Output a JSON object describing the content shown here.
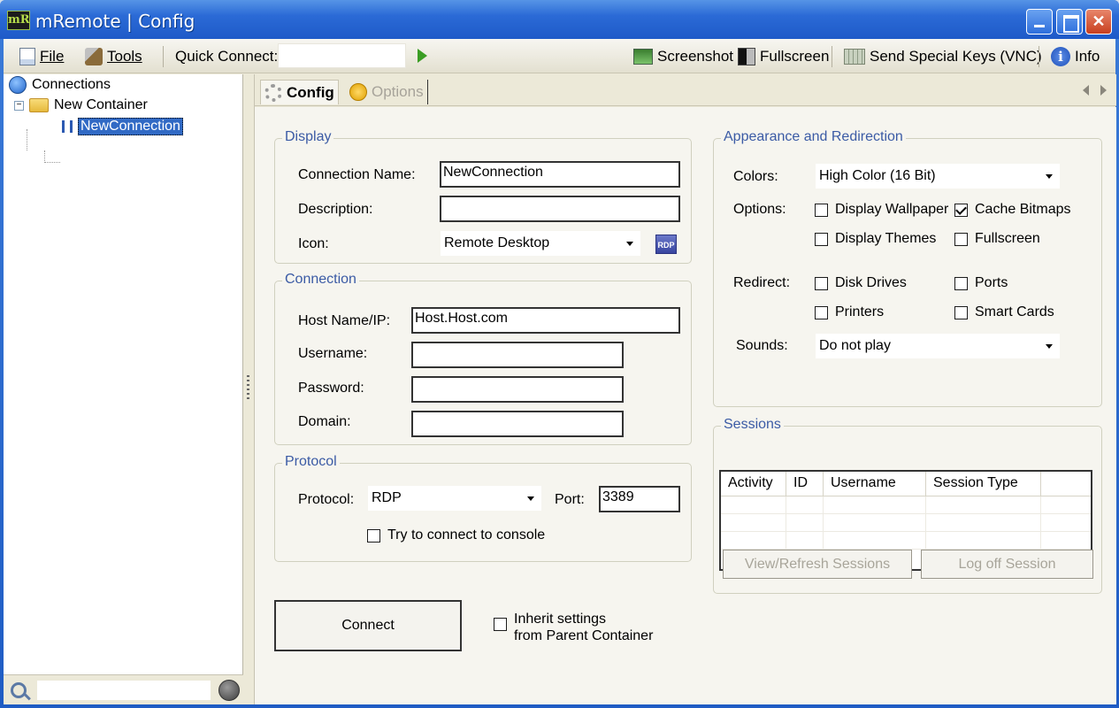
{
  "window": {
    "title": "mRemote | Config",
    "logo_text": "mR"
  },
  "toolbar": {
    "file_label": "File",
    "tools_label": "Tools",
    "quick_connect_label": "Quick Connect:",
    "quick_connect_value": "",
    "screenshot_label": "Screenshot",
    "fullscreen_label": "Fullscreen",
    "send_keys_label": "Send Special Keys (VNC)",
    "info_label": "Info"
  },
  "tree": {
    "root_label": "Connections",
    "container_label": "New Container",
    "connection_label": "NewConnection",
    "search_value": ""
  },
  "tabs": {
    "config_label": "Config",
    "options_label": "Options"
  },
  "display": {
    "title": "Display",
    "connection_name_label": "Connection Name:",
    "connection_name_value": "NewConnection",
    "description_label": "Description:",
    "description_value": "",
    "icon_label": "Icon:",
    "icon_value": "Remote Desktop",
    "icon_badge": "RDP"
  },
  "connection": {
    "title": "Connection",
    "host_label": "Host Name/IP:",
    "host_value": "Host.Host.com",
    "username_label": "Username:",
    "username_value": "",
    "password_label": "Password:",
    "password_value": "",
    "domain_label": "Domain:",
    "domain_value": ""
  },
  "protocol": {
    "title": "Protocol",
    "protocol_label": "Protocol:",
    "protocol_value": "RDP",
    "port_label": "Port:",
    "port_value": "3389",
    "console_label": "Try to connect to console",
    "console_checked": false
  },
  "actions": {
    "connect_label": "Connect",
    "inherit_line1": "Inherit settings",
    "inherit_line2": "from Parent Container",
    "inherit_checked": false
  },
  "appearance": {
    "title": "Appearance and Redirection",
    "colors_label": "Colors:",
    "colors_value": "High Color (16 Bit)",
    "options_label": "Options:",
    "display_wallpaper": "Display Wallpaper",
    "cache_bitmaps": "Cache Bitmaps",
    "display_themes": "Display Themes",
    "fullscreen": "Fullscreen",
    "redirect_label": "Redirect:",
    "disk_drives": "Disk Drives",
    "ports": "Ports",
    "printers": "Printers",
    "smart_cards": "Smart Cards",
    "sounds_label": "Sounds:",
    "sounds_value": "Do not play",
    "checked": {
      "display_wallpaper": false,
      "cache_bitmaps": true,
      "display_themes": false,
      "fullscreen": false,
      "disk_drives": false,
      "ports": false,
      "printers": false,
      "smart_cards": false
    }
  },
  "sessions": {
    "title": "Sessions",
    "columns": [
      "Activity",
      "ID",
      "Username",
      "Session Type"
    ],
    "rows": [],
    "view_refresh_label": "View/Refresh Sessions",
    "log_off_label": "Log off Session"
  },
  "colors": {
    "title_bar": "#2b6ad6",
    "group_title": "#3b5ba5",
    "selection": "#316ac5",
    "play_icon": "#3a9d23"
  }
}
